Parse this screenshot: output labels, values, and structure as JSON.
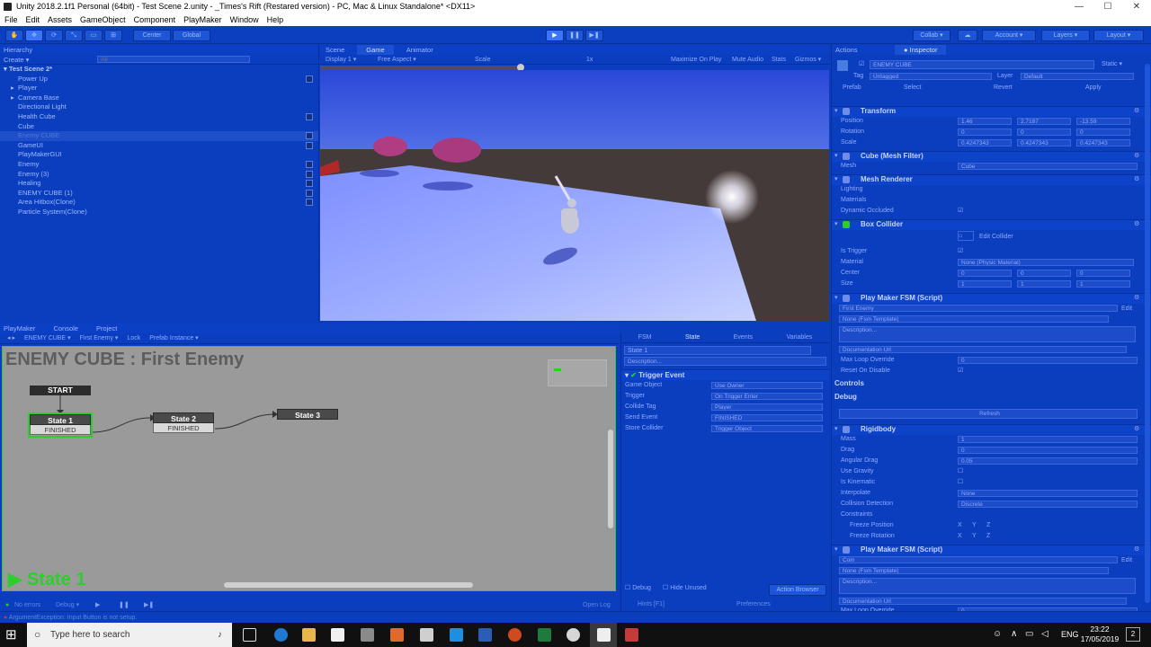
{
  "window": {
    "title": "Unity 2018.2.1f1 Personal (64bit) - Test Scene 2.unity - _Times's Rift (Restared version) - PC, Mac & Linux Standalone* <DX11>",
    "controls": [
      "—",
      "☐",
      "✕"
    ]
  },
  "menu": [
    "File",
    "Edit",
    "Assets",
    "GameObject",
    "Component",
    "PlayMaker",
    "Window",
    "Help"
  ],
  "toolbar": {
    "pivot": "Center",
    "space": "Global",
    "collab": "Collab ▾",
    "account": "Account ▾",
    "layers": "Layers ▾",
    "layout": "Layout ▾"
  },
  "hierarchy": {
    "tab": "Hierarchy",
    "create": "Create ▾",
    "search_placeholder": "All",
    "scene": "Test Scene 2*",
    "items": [
      {
        "label": "Power Up",
        "arrow": "",
        "badge": true,
        "selected": false
      },
      {
        "label": "Player",
        "arrow": "▸",
        "badge": false,
        "selected": false
      },
      {
        "label": "Camera Base",
        "arrow": "▸",
        "badge": false,
        "selected": false
      },
      {
        "label": "Directional Light",
        "arrow": "",
        "badge": false,
        "selected": false
      },
      {
        "label": "Health Cube",
        "arrow": "",
        "badge": true,
        "selected": false
      },
      {
        "label": "Cube",
        "arrow": "",
        "badge": false,
        "selected": false
      },
      {
        "label": "Enemy CUBE",
        "arrow": "",
        "badge": true,
        "selected": true
      },
      {
        "label": "GameUI",
        "arrow": "",
        "badge": true,
        "selected": false
      },
      {
        "label": "PlayMakerGUI",
        "arrow": "",
        "badge": false,
        "selected": false
      },
      {
        "label": "Enemy",
        "arrow": "",
        "badge": true,
        "selected": false
      },
      {
        "label": "Enemy (3)",
        "arrow": "",
        "badge": true,
        "selected": false
      },
      {
        "label": "Healing",
        "arrow": "",
        "badge": true,
        "selected": false
      },
      {
        "label": "ENEMY CUBE (1)",
        "arrow": "",
        "badge": true,
        "selected": false
      },
      {
        "label": "Area Hitbox(Clone)",
        "arrow": "",
        "badge": true,
        "selected": false
      },
      {
        "label": "Particle System(Clone)",
        "arrow": "",
        "badge": false,
        "selected": false
      }
    ]
  },
  "game": {
    "tabs": [
      "Scene",
      "Game",
      "Animator"
    ],
    "display": "Display 1 ▾",
    "aspect": "Free Aspect ▾",
    "scale_label": "Scale",
    "scale_value": "1x",
    "options": [
      "Maximize On Play",
      "Mute Audio",
      "Stats",
      "Gizmos ▾"
    ]
  },
  "playmaker": {
    "tabs": [
      "PlayMaker",
      "Console",
      "Project"
    ],
    "breadcrumbs": [
      "ENEMY CUBE ▾",
      "First Enemy ▾",
      "Lock",
      "Prefab Instance ▾"
    ],
    "graph_title": "ENEMY CUBE : First Enemy",
    "start_label": "START",
    "states": [
      {
        "name": "State 1",
        "event": "FINISHED"
      },
      {
        "name": "State 2",
        "event": "FINISHED"
      },
      {
        "name": "State 3",
        "event": ""
      }
    ],
    "active_state": "State 1",
    "footer_left": "No errors",
    "footer_debug": "Debug ▾",
    "footer_right": "Open Log"
  },
  "fsm_panel": {
    "tabs": [
      "FSM",
      "State",
      "Events",
      "Variables"
    ],
    "state_name": "State 1",
    "description_placeholder": "Description...",
    "action_title": "Trigger Event",
    "fields": [
      {
        "label": "Game Object",
        "value": "Use Owner"
      },
      {
        "label": "Trigger",
        "value": "On Trigger Enter"
      },
      {
        "label": "Collide Tag",
        "value": "Player"
      },
      {
        "label": "Send Event",
        "value": "FINISHED"
      },
      {
        "label": "Store Collider",
        "value": "Trigger Object"
      }
    ],
    "debug": "Debug",
    "hide_unused": "Hide Unused",
    "action_browser": "Action Browser",
    "hints": "Hints [F1]",
    "preferences": "Preferences"
  },
  "inspector": {
    "tabs": [
      "Actions",
      "Inspector"
    ],
    "object_name": "ENEMY CUBE",
    "static": "Static ▾",
    "tag_label": "Tag",
    "tag": "Untagged",
    "layer_label": "Layer",
    "layer": "Default",
    "prefab_label": "Prefab",
    "prefab_buttons": [
      "Select",
      "Revert",
      "Apply"
    ],
    "transform": {
      "title": "Transform",
      "rows": [
        {
          "label": "Position",
          "x": "1.46",
          "y": "2.7187",
          "z": "-13.59"
        },
        {
          "label": "Rotation",
          "x": "0",
          "y": "0",
          "z": "0"
        },
        {
          "label": "Scale",
          "x": "0.4247343",
          "y": "0.4247343",
          "z": "0.4247343"
        }
      ]
    },
    "mesh_filter": {
      "title": "Cube (Mesh Filter)",
      "mesh_label": "Mesh",
      "mesh": "Cube"
    },
    "mesh_renderer": {
      "title": "Mesh Renderer",
      "lighting": "Lighting",
      "materials": "Materials",
      "occluded": "Dynamic Occluded"
    },
    "box_collider": {
      "title": "Box Collider",
      "edit": "Edit Collider",
      "is_trigger": "Is Trigger",
      "material_label": "Material",
      "material": "None (Physic Material)",
      "center_label": "Center",
      "center": [
        "0",
        "0",
        "0"
      ],
      "size_label": "Size",
      "size": [
        "1",
        "1",
        "1"
      ]
    },
    "fsm1": {
      "title": "Play Maker FSM (Script)",
      "name": "First Enemy",
      "edit": "Edit",
      "template": "None (Fsm Template)",
      "description": "Description...",
      "doc_url": "Documentation Url",
      "max_loop": "Max Loop Override",
      "max_loop_value": "0",
      "reset": "Reset On Disable",
      "controls": "Controls",
      "debug": "Debug",
      "refresh": "Refresh"
    },
    "rigidbody": {
      "title": "Rigidbody",
      "rows": [
        {
          "label": "Mass",
          "value": "1"
        },
        {
          "label": "Drag",
          "value": "0"
        },
        {
          "label": "Angular Drag",
          "value": "0.05"
        },
        {
          "label": "Use Gravity",
          "value": ""
        },
        {
          "label": "Is Kinematic",
          "value": ""
        },
        {
          "label": "Interpolate",
          "value": "None"
        },
        {
          "label": "Collision Detection",
          "value": "Discrete"
        }
      ],
      "constraints": "Constraints",
      "freeze_pos": "Freeze Position",
      "freeze_rot": "Freeze Rotation",
      "axes": [
        "X",
        "Y",
        "Z"
      ]
    },
    "fsm2": {
      "title": "Play Maker FSM (Script)",
      "name": "Coin",
      "edit": "Edit",
      "template": "None (Fsm Template)",
      "description": "Description...",
      "doc_url": "Documentation Url",
      "max_loop": "Max Loop Override",
      "max_loop_value": "0"
    }
  },
  "status_bar": "ArgumentException: Input Button  is not setup.",
  "taskbar": {
    "search_placeholder": "Type here to search",
    "lang": "ENG",
    "time": "23:22",
    "date": "17/05/2019",
    "notif": "2"
  }
}
